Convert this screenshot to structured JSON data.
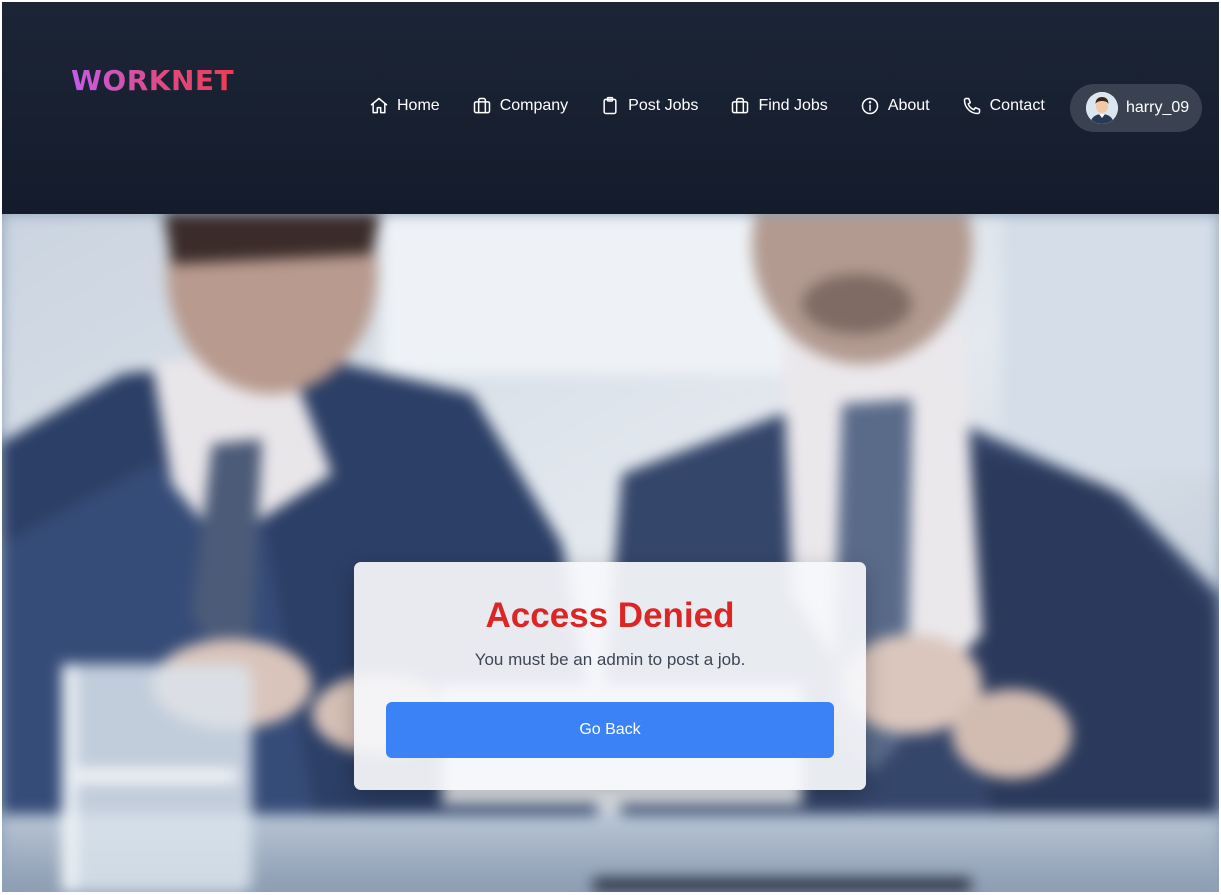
{
  "brand": {
    "logo_text": "WORKNET"
  },
  "nav": {
    "items": [
      {
        "label": "Home",
        "icon": "home-icon"
      },
      {
        "label": "Company",
        "icon": "briefcase-icon"
      },
      {
        "label": "Post Jobs",
        "icon": "clipboard-icon"
      },
      {
        "label": "Find Jobs",
        "icon": "briefcase-icon"
      },
      {
        "label": "About",
        "icon": "info-icon"
      },
      {
        "label": "Contact",
        "icon": "phone-icon"
      }
    ]
  },
  "user": {
    "username": "harry_09",
    "avatar_icon": "user-avatar"
  },
  "hero": {
    "background": "blurred photo of two businessmen in suits at a meeting table"
  },
  "dialog": {
    "title": "Access Denied",
    "message": "You must be an admin to post a job.",
    "button_label": "Go Back"
  },
  "colors": {
    "header_bg": "#1b2434",
    "logo_gradient_start": "#c45ce6",
    "logo_gradient_end": "#f03a54",
    "error_title": "#dc2626",
    "primary_button": "#3b82f6",
    "user_pill_bg": "#3a4252"
  }
}
